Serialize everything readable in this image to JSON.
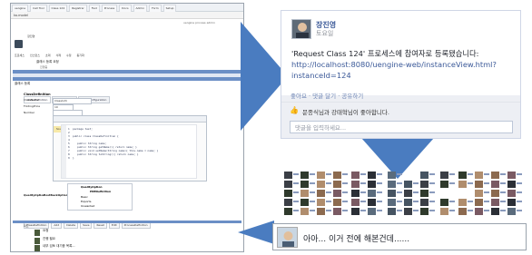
{
  "left_screenshot": {
    "tabs": [
      "uengine",
      "Call Tool",
      "Class 124",
      "Registrar",
      "Fwd",
      "Process",
      "Docs",
      "Admin",
      "Form",
      "Setup"
    ],
    "url": "ko.model",
    "header_text": "uengine  process  admin",
    "user_label": "장진영",
    "toolbar_items": [
      "프로세스",
      "인스턴스",
      "초대",
      "삭제",
      "수정",
      "동기화"
    ],
    "process_item": "클래스 등록 요청",
    "process_subitem": "진행중",
    "form_title": "클래스 등록",
    "section_tabs": [
      "ClassDefinition",
      "Registrations",
      "FieldConfiguration"
    ],
    "class_def_heading": "ClassDefinition",
    "fields": [
      {
        "label": "ClassName",
        "value": "Class124"
      },
      {
        "label": "FoldingPrice",
        "value": "10"
      },
      {
        "label": "Number",
        "value": ""
      }
    ],
    "code_tabs": [
      "SourceCode",
      "FormHolder",
      "Form",
      "Description"
    ],
    "code_lines": [
      "1  package test;",
      "2",
      "3  public class ClassDefinition {",
      "4",
      "5     public String name;",
      "6     public String getName(){ return name; }",
      "7     public void setName(String name){ this.name = name; }",
      "8     public String toString(){ return name; }",
      "9  }"
    ],
    "qualification": {
      "heading": "QualityOption",
      "sub_heading": "PREDefinition",
      "rows": [
        "Basic",
        "Exports",
        "Unwanted"
      ],
      "left_label": "QualityOption",
      "mid_label": "PostBackOption"
    },
    "bottom_tabs": [
      "ClassDefinition",
      "Add",
      "Delete",
      "Save",
      "Reset",
      "Edit",
      "ProcessDefinition"
    ],
    "feed_label": "피드",
    "feed_items": [
      "요청",
      "진행 필요",
      "내부 검토 대기중 목록..."
    ]
  },
  "fb_post": {
    "author": "장진영",
    "time": "토요일",
    "message": "'Request Class 124' 프로세스에 참여자로 등록됐습니다:",
    "link_line1": "http://localhost:8080/uengine-web/instanceView.html?",
    "link_line2": "instanceId=124",
    "actions": "좋아요 · 댓글 달기 · 공유하기",
    "likes": "문종식님과 강태혁님이 좋아합니다.",
    "comment_placeholder": "댓글을 입력하세요..."
  },
  "comment": {
    "text": "아아... 이거 전에 해본건데......"
  },
  "colors": {
    "fb_blue": "#3b5998",
    "fb_bg": "#edeff4",
    "arrow_blue": "#4a7cc0",
    "tab_bar_blue": "#6b8fc6"
  },
  "icons": {
    "like": "thumbs-up-icon"
  }
}
